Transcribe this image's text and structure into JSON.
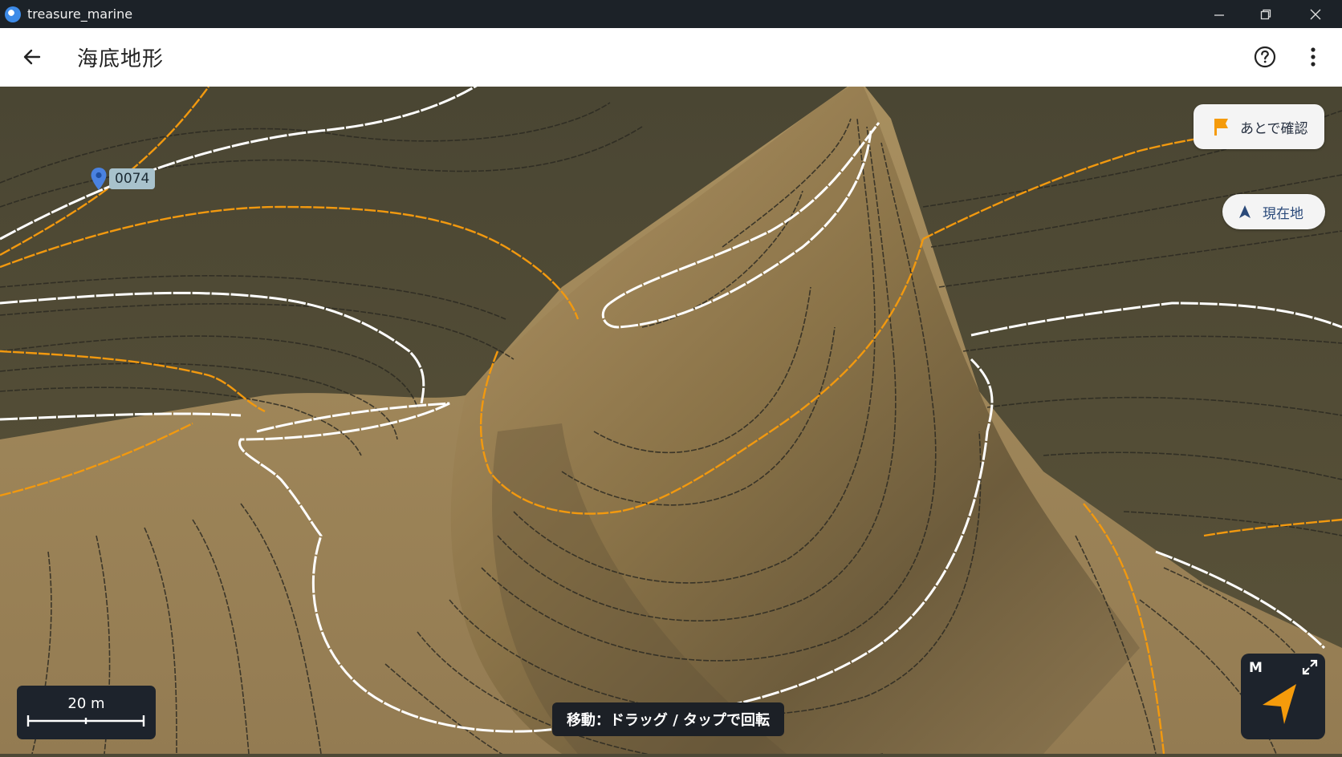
{
  "window": {
    "title": "treasure_marine",
    "icon": "app-logo-icon",
    "controls": [
      "minimize-icon",
      "restore-icon",
      "close-icon"
    ]
  },
  "appbar": {
    "title": "海底地形",
    "back_icon": "arrow-left-icon",
    "help_icon": "help-circle-icon",
    "more_icon": "more-vertical-icon"
  },
  "map": {
    "marker": {
      "label": "0074",
      "icon": "map-pin-icon",
      "color": "#4a82e0"
    },
    "check_later": {
      "label": "あとで確認",
      "icon": "flag-icon",
      "icon_color": "#f59b0b"
    },
    "current_location": {
      "label": "現在地",
      "icon": "navigation-arrow-icon"
    },
    "scale": {
      "label": "20 m"
    },
    "hint": "移動：ドラッグ / タップで回転",
    "compass": {
      "mode": "M",
      "expand_icon": "expand-icon",
      "arrow_icon": "navigation-arrow-icon",
      "arrow_color": "#f59b0b"
    },
    "colors": {
      "seabed_dark": "#4d4936",
      "seabed_light": "#a88f5e",
      "contour_major": "#f2990f",
      "contour_index": "#ffffff",
      "contour_minor": "#2a2a2a"
    }
  }
}
